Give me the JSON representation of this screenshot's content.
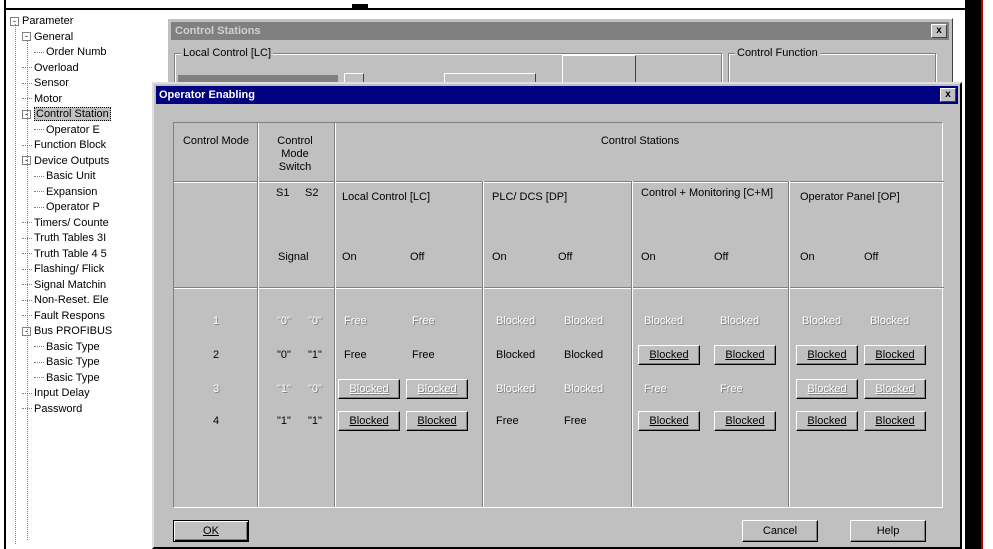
{
  "tree": {
    "items": [
      {
        "label": "Parameter",
        "indent": 0,
        "expander": "-"
      },
      {
        "label": "General",
        "indent": 1,
        "expander": "-"
      },
      {
        "label": "Order Numb",
        "indent": 2
      },
      {
        "label": "Overload",
        "indent": 1
      },
      {
        "label": "Sensor",
        "indent": 1
      },
      {
        "label": "Motor",
        "indent": 1
      },
      {
        "label": "Control Station",
        "indent": 1,
        "expander": "-",
        "selected": true
      },
      {
        "label": "Operator E",
        "indent": 2
      },
      {
        "label": "Function Block",
        "indent": 1
      },
      {
        "label": "Device Outputs",
        "indent": 1,
        "expander": "-"
      },
      {
        "label": "Basic Unit",
        "indent": 2
      },
      {
        "label": "Expansion",
        "indent": 2
      },
      {
        "label": "Operator P",
        "indent": 2
      },
      {
        "label": "Timers/ Counte",
        "indent": 1
      },
      {
        "label": "Truth Tables 3I",
        "indent": 1
      },
      {
        "label": "Truth Table 4 5",
        "indent": 1
      },
      {
        "label": "Flashing/ Flick",
        "indent": 1
      },
      {
        "label": "Signal Matchin",
        "indent": 1
      },
      {
        "label": "Non-Reset. Ele",
        "indent": 1
      },
      {
        "label": "Fault Respons",
        "indent": 1
      },
      {
        "label": "Bus PROFIBUS",
        "indent": 1,
        "expander": "-"
      },
      {
        "label": "Basic Type",
        "indent": 2
      },
      {
        "label": "Basic Type",
        "indent": 2
      },
      {
        "label": "Basic Type",
        "indent": 2
      },
      {
        "label": "Input Delay",
        "indent": 1
      },
      {
        "label": "Password",
        "indent": 1
      }
    ]
  },
  "bg_window": {
    "title": "Control Stations",
    "close": "x",
    "group_local": "Local Control [LC]",
    "group_function": "Control Function"
  },
  "dialog": {
    "title": "Operator Enabling",
    "close": "x",
    "headers": {
      "control_mode": "Control Mode",
      "control_mode_switch": "Control Mode Switch",
      "control_stations": "Control Stations",
      "s1": "S1",
      "s2": "S2",
      "signal": "Signal",
      "stations": [
        "Local Control [LC]",
        "PLC/ DCS [DP]",
        "Control + Monitoring [C+M]",
        "Operator Panel [OP]"
      ],
      "on": "On",
      "off": "Off"
    },
    "rows": [
      {
        "mode": "1",
        "s1": "\"0\"",
        "s2": "\"0\"",
        "enabled": false,
        "cells": [
          {
            "text": "Free",
            "button": false
          },
          {
            "text": "Free",
            "button": false
          },
          {
            "text": "Blocked",
            "button": false
          },
          {
            "text": "Blocked",
            "button": false
          },
          {
            "text": "Blocked",
            "button": false
          },
          {
            "text": "Blocked",
            "button": false
          },
          {
            "text": "Blocked",
            "button": false
          },
          {
            "text": "Blocked",
            "button": false
          }
        ]
      },
      {
        "mode": "2",
        "s1": "\"0\"",
        "s2": "\"1\"",
        "enabled": true,
        "cells": [
          {
            "text": "Free",
            "button": false
          },
          {
            "text": "Free",
            "button": false
          },
          {
            "text": "Blocked",
            "button": false
          },
          {
            "text": "Blocked",
            "button": false
          },
          {
            "text": "Blocked",
            "button": true
          },
          {
            "text": "Blocked",
            "button": true
          },
          {
            "text": "Blocked",
            "button": true
          },
          {
            "text": "Blocked",
            "button": true
          }
        ]
      },
      {
        "mode": "3",
        "s1": "\"1\"",
        "s2": "\"0\"",
        "enabled": false,
        "cells": [
          {
            "text": "Blocked",
            "button": true
          },
          {
            "text": "Blocked",
            "button": true
          },
          {
            "text": "Blocked",
            "button": false
          },
          {
            "text": "Blocked",
            "button": false
          },
          {
            "text": "Free",
            "button": false
          },
          {
            "text": "Free",
            "button": false
          },
          {
            "text": "Blocked",
            "button": true
          },
          {
            "text": "Blocked",
            "button": true
          }
        ]
      },
      {
        "mode": "4",
        "s1": "\"1\"",
        "s2": "\"1\"",
        "enabled": true,
        "cells": [
          {
            "text": "Blocked",
            "button": true
          },
          {
            "text": "Blocked",
            "button": true
          },
          {
            "text": "Free",
            "button": false
          },
          {
            "text": "Free",
            "button": false
          },
          {
            "text": "Blocked",
            "button": true
          },
          {
            "text": "Blocked",
            "button": true
          },
          {
            "text": "Blocked",
            "button": true
          },
          {
            "text": "Blocked",
            "button": true
          }
        ]
      }
    ],
    "buttons": {
      "ok": "OK",
      "cancel": "Cancel",
      "help": "Help"
    }
  },
  "colors": {
    "titlebar_active": "#000080",
    "face": "#c0c0c0",
    "selection": "#c0c0c0"
  }
}
